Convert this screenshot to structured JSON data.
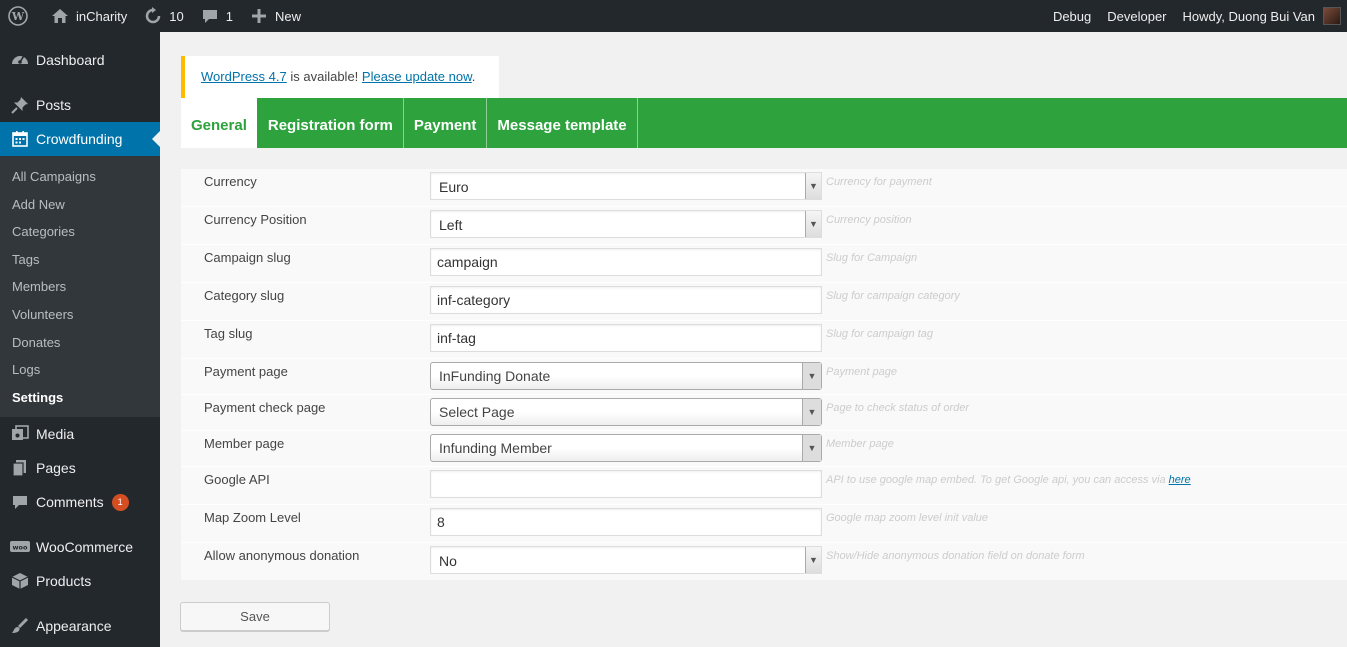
{
  "adminbar": {
    "site_name": "inCharity",
    "updates_count": "10",
    "comments_count": "1",
    "new_label": "New",
    "debug_label": "Debug",
    "developer_label": "Developer",
    "howdy_label": "Howdy, Duong Bui Van"
  },
  "sidebar": {
    "dashboard": "Dashboard",
    "posts": "Posts",
    "crowdfunding": "Crowdfunding",
    "submenu": [
      "All Campaigns",
      "Add New",
      "Categories",
      "Tags",
      "Members",
      "Volunteers",
      "Donates",
      "Logs",
      "Settings"
    ],
    "media": "Media",
    "pages": "Pages",
    "comments": "Comments",
    "comments_badge": "1",
    "woocommerce": "WooCommerce",
    "products": "Products",
    "appearance": "Appearance"
  },
  "notice": {
    "link1": "WordPress 4.7",
    "middle": " is available! ",
    "link2": "Please update now",
    "end": "."
  },
  "tabs": [
    "General",
    "Registration form",
    "Payment",
    "Message template"
  ],
  "settings": {
    "currency": {
      "label": "Currency",
      "value": "Euro",
      "desc": "Currency for payment"
    },
    "currency_position": {
      "label": "Currency Position",
      "value": "Left",
      "desc": "Currency position"
    },
    "campaign_slug": {
      "label": "Campaign slug",
      "value": "campaign",
      "desc": "Slug for Campaign"
    },
    "category_slug": {
      "label": "Category slug",
      "value": "inf-category",
      "desc": "Slug for campaign category"
    },
    "tag_slug": {
      "label": "Tag slug",
      "value": "inf-tag",
      "desc": "Slug for campaign tag"
    },
    "payment_page": {
      "label": "Payment page",
      "value": "InFunding Donate",
      "desc": "Payment page"
    },
    "payment_check_page": {
      "label": "Payment check page",
      "value": "Select Page",
      "desc": "Page to check status of order"
    },
    "member_page": {
      "label": "Member page",
      "value": "Infunding Member",
      "desc": "Member page"
    },
    "google_api": {
      "label": "Google API",
      "value": "",
      "desc": "API to use google map embed. To get Google api, you can access via ",
      "desc_link": "here"
    },
    "map_zoom": {
      "label": "Map Zoom Level",
      "value": "8",
      "desc": "Google map zoom level init value"
    },
    "anonymous": {
      "label": "Allow anonymous donation",
      "value": "No",
      "desc": "Show/Hide anonymous donation field on donate form"
    }
  },
  "save_label": "Save"
}
